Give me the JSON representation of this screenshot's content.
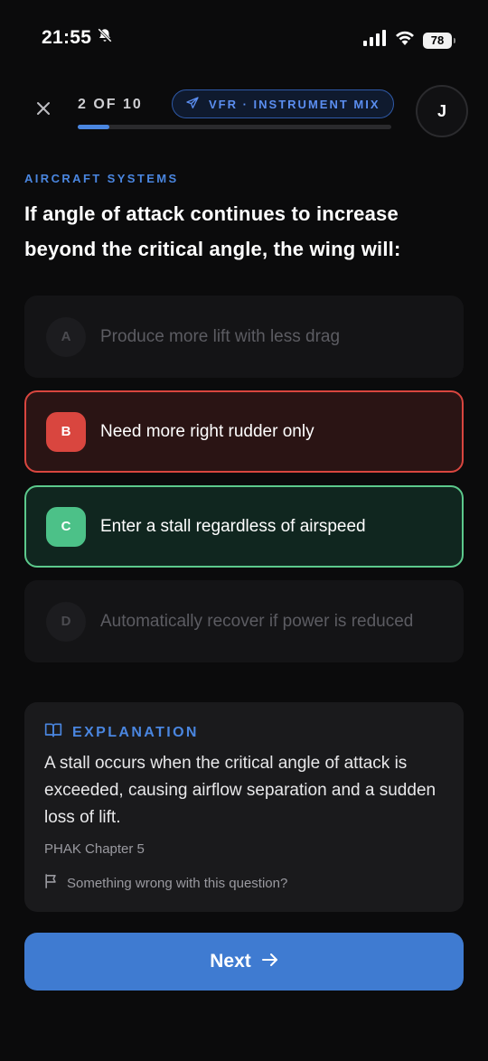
{
  "status_bar": {
    "time": "21:55",
    "battery": "78"
  },
  "header": {
    "progress_label": "2 OF 10",
    "progress_fraction": 0.1,
    "mode_label": "VFR · INSTRUMENT MIX",
    "avatar_initial": "J"
  },
  "question": {
    "category": "AIRCRAFT SYSTEMS",
    "text": "If angle of attack continues to increase beyond the critical angle, the wing will:"
  },
  "answers": [
    {
      "letter": "A",
      "text": "Produce more lift with less drag",
      "state": "dim"
    },
    {
      "letter": "B",
      "text": "Need more right rudder only",
      "state": "wrong"
    },
    {
      "letter": "C",
      "text": "Enter a stall regardless of airspeed",
      "state": "correct"
    },
    {
      "letter": "D",
      "text": "Automatically recover if power is reduced",
      "state": "dim"
    }
  ],
  "explanation": {
    "title": "EXPLANATION",
    "body": "A stall occurs when the critical angle of attack is exceeded, causing airflow separation and a sudden loss of lift.",
    "source": "PHAK Chapter 5",
    "report_label": "Something wrong with this question?"
  },
  "footer": {
    "next_label": "Next"
  },
  "colors": {
    "accent": "#4a86e0",
    "wrong": "#d9463f",
    "correct": "#4cc188",
    "background": "#0b0b0c"
  },
  "icons": [
    "bell-slash-icon",
    "signal-icon",
    "wifi-icon",
    "battery-icon",
    "close-icon",
    "airplane-icon",
    "book-icon",
    "flag-icon",
    "arrow-right-icon"
  ]
}
